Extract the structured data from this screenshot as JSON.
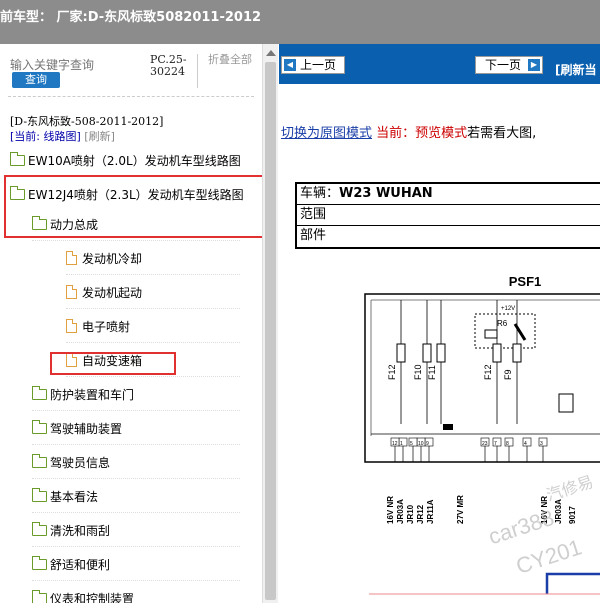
{
  "header": {
    "title": "前车型：  厂家:D-东风标致5082011-2012"
  },
  "left": {
    "search_placeholder": "输入关键字查询",
    "search_button": "查询",
    "pc_code": "PC.25-30224",
    "collapse_all": "折叠全部",
    "breadcrumb": "[D-东风标致-508-2011-2012]",
    "current_label": "[当前: 线路图]",
    "refresh_label": "[刷新]",
    "tree": [
      {
        "label": "EW10A喷射（2.0L）发动机车型线路图",
        "icon": "folder-icon",
        "level": 0
      },
      {
        "label": "EW12J4喷射（2.3L）发动机车型线路图",
        "icon": "folder-open-icon",
        "level": 0
      },
      {
        "label": "动力总成",
        "icon": "folder-open-icon",
        "level": 1
      },
      {
        "label": "发动机冷却",
        "icon": "file-icon",
        "level": 2
      },
      {
        "label": "发动机起动",
        "icon": "file-icon",
        "level": 2
      },
      {
        "label": "电子喷射",
        "icon": "file-icon",
        "level": 2
      },
      {
        "label": "自动变速箱",
        "icon": "file-icon",
        "level": 2
      },
      {
        "label": "防护装置和车门",
        "icon": "folder-icon",
        "level": 1
      },
      {
        "label": "驾驶辅助装置",
        "icon": "folder-icon",
        "level": 1
      },
      {
        "label": "驾驶员信息",
        "icon": "folder-icon",
        "level": 1
      },
      {
        "label": "基本看法",
        "icon": "folder-icon",
        "level": 1
      },
      {
        "label": "清洗和雨刮",
        "icon": "folder-icon",
        "level": 1
      },
      {
        "label": "舒适和便利",
        "icon": "folder-icon",
        "level": 1
      },
      {
        "label": "仪表和控制装置",
        "icon": "folder-icon",
        "level": 1
      }
    ]
  },
  "viewer": {
    "prev_button": "上一页",
    "next_button": "下一页",
    "refresh_current": "[刷新当",
    "mode_link": "切换为原图模式",
    "mode_current": "当前：预览模式",
    "mode_hint": "若需看大图,",
    "info": {
      "vehicle_label": "车辆：",
      "vehicle_value": "W23 WUHAN",
      "range_label": "范围",
      "part_label": "部件"
    },
    "diagram": {
      "title": "PSF1",
      "voltage": "+12V",
      "relay": "R6",
      "fuses": [
        "F12",
        "F10",
        "F11",
        "F12",
        "F9"
      ],
      "pins": [
        "23",
        "7",
        "8",
        "4",
        "3",
        "9",
        "10",
        "5",
        "1",
        "12"
      ],
      "wires": [
        "16V NR",
        "JR03A",
        "JR10",
        "JR12",
        "JR11A",
        "27V MR",
        "16V NR",
        "JR03A",
        "9017"
      ],
      "watermark": [
        "car388",
        "CY201",
        "汽修易"
      ]
    }
  }
}
